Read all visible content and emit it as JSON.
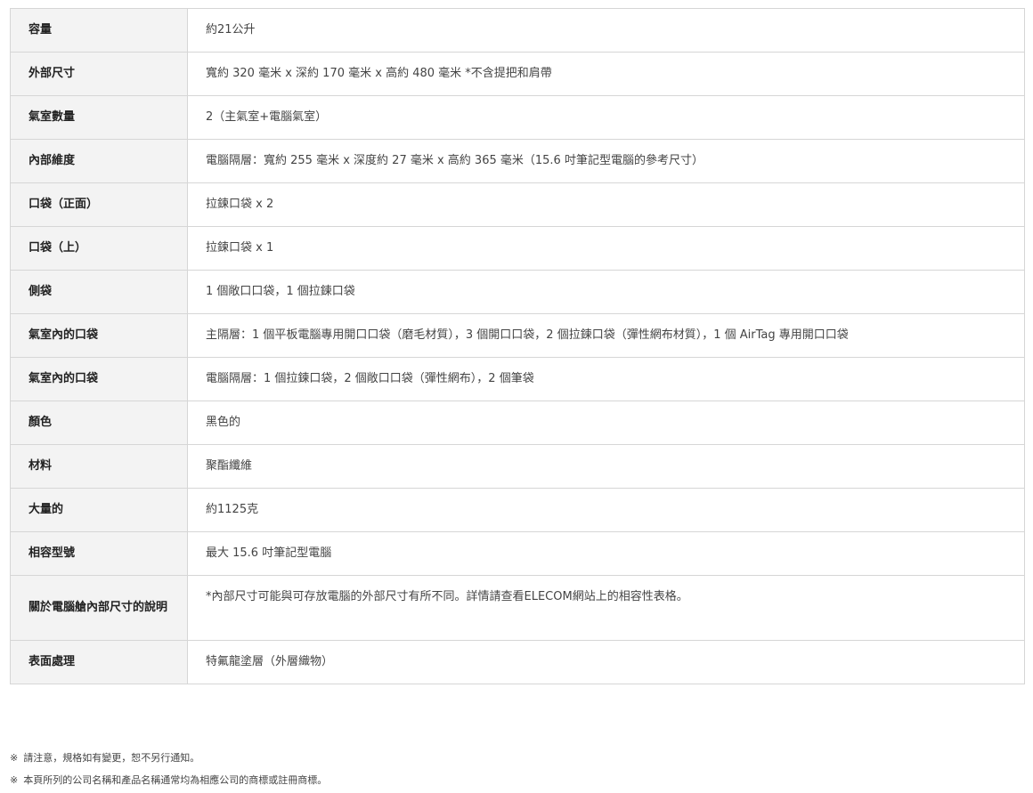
{
  "specs": [
    {
      "label": "容量",
      "value": "約21公升"
    },
    {
      "label": "外部尺寸",
      "value": "寬約 320 毫米 x 深約 170 毫米 x 高約 480 毫米 *不含提把和肩帶"
    },
    {
      "label": "氣室數量",
      "value": "2（主氣室+電腦氣室）"
    },
    {
      "label": "內部維度",
      "value": "電腦隔層：寬約 255 毫米 x 深度約 27 毫米 x 高約 365 毫米（15.6 吋筆記型電腦的參考尺寸）"
    },
    {
      "label": "口袋（正面）",
      "value": "拉鍊口袋 x 2"
    },
    {
      "label": "口袋（上）",
      "value": "拉鍊口袋 x 1"
    },
    {
      "label": "側袋",
      "value": "1 個敞口口袋，1 個拉鍊口袋"
    },
    {
      "label": "氣室內的口袋",
      "value": "主隔層：1 個平板電腦專用開口口袋（磨毛材質），3 個開口口袋，2 個拉鍊口袋（彈性網布材質），1 個 AirTag 專用開口口袋"
    },
    {
      "label": "氣室內的口袋",
      "value": "電腦隔層：1 個拉鍊口袋，2 個敞口口袋（彈性網布），2 個筆袋"
    },
    {
      "label": "顏色",
      "value": "黑色的"
    },
    {
      "label": "材料",
      "value": "聚酯纖維"
    },
    {
      "label": "大量的",
      "value": "約1125克"
    },
    {
      "label": "相容型號",
      "value": "最大 15.6 吋筆記型電腦"
    },
    {
      "label": "關於電腦艙內部尺寸的說明",
      "value": "*內部尺寸可能與可存放電腦的外部尺寸有所不同。詳情請查看ELECOM網站上的相容性表格。"
    },
    {
      "label": "表面處理",
      "value": "特氟龍塗層（外層織物）"
    }
  ],
  "notes": {
    "mark": "※",
    "items": [
      "請注意，規格如有變更，恕不另行通知。",
      "本頁所列的公司名稱和產品名稱通常均為相應公司的商標或註冊商標。"
    ]
  }
}
